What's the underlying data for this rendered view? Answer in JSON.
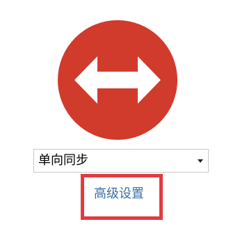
{
  "sync_icon": {
    "icon": "two-way-arrow-icon",
    "circle_color": "#d13b2c",
    "arrow_color": "#ffffff"
  },
  "sync_mode_select": {
    "selected_value": "单向同步"
  },
  "advanced_settings": {
    "label": "高级设置",
    "link_color": "#3b6fa8",
    "highlight_border_color": "#e23b3f"
  }
}
